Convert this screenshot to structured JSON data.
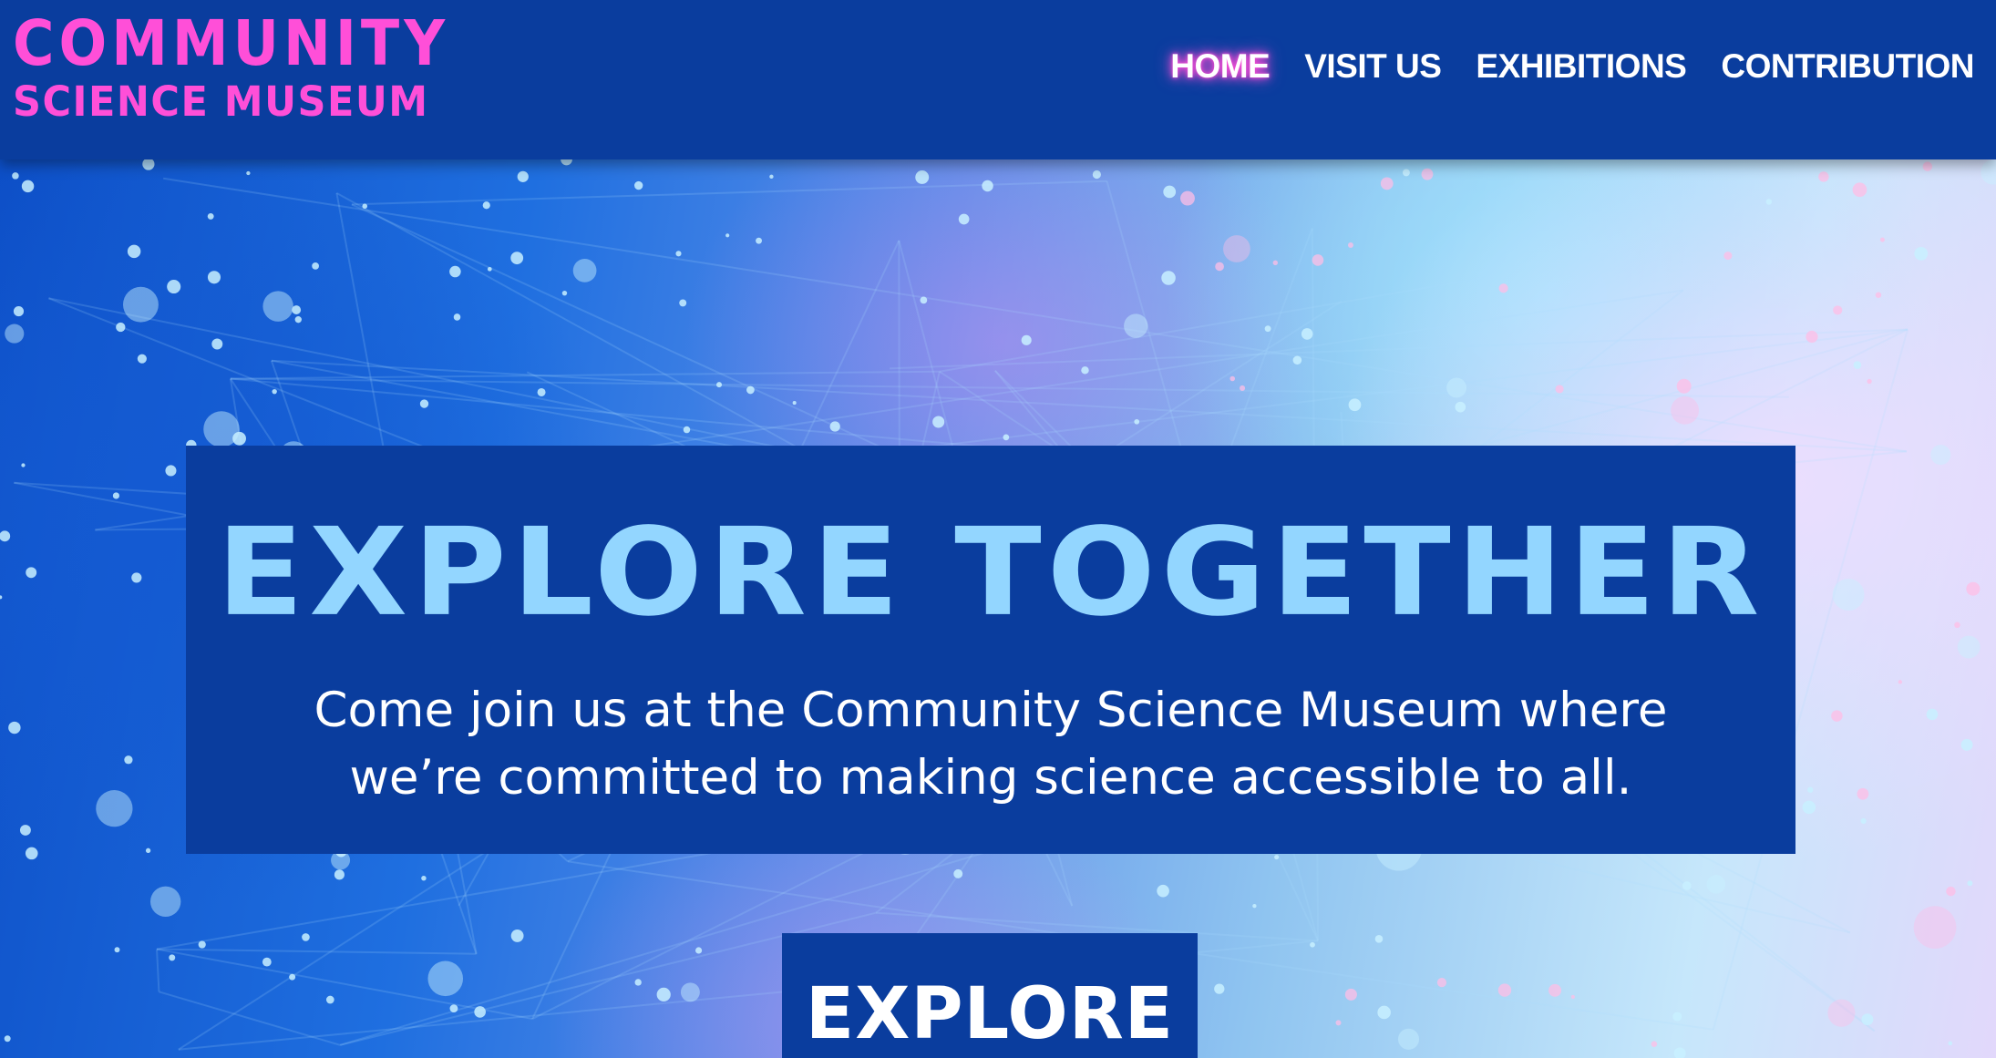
{
  "brand": {
    "line1": "COMMUNITY",
    "line2": "SCIENCE MUSEUM",
    "color": "#ff4fd8"
  },
  "nav": {
    "items": [
      {
        "label": "HOME",
        "active": true
      },
      {
        "label": "VISIT US",
        "active": false
      },
      {
        "label": "EXHIBITIONS",
        "active": false
      },
      {
        "label": "CONTRIBUTION",
        "active": false
      }
    ]
  },
  "hero": {
    "title": "EXPLORE TOGETHER",
    "subtitle": "Come join us at the Community Science Museum where we’re committed to making science accessible to all.",
    "button_label": "EXPLORE",
    "background_image": "abstract blue particle network",
    "colors": {
      "panel": "#0a3d9e",
      "title": "#93d6ff",
      "text": "#ffffff"
    }
  }
}
